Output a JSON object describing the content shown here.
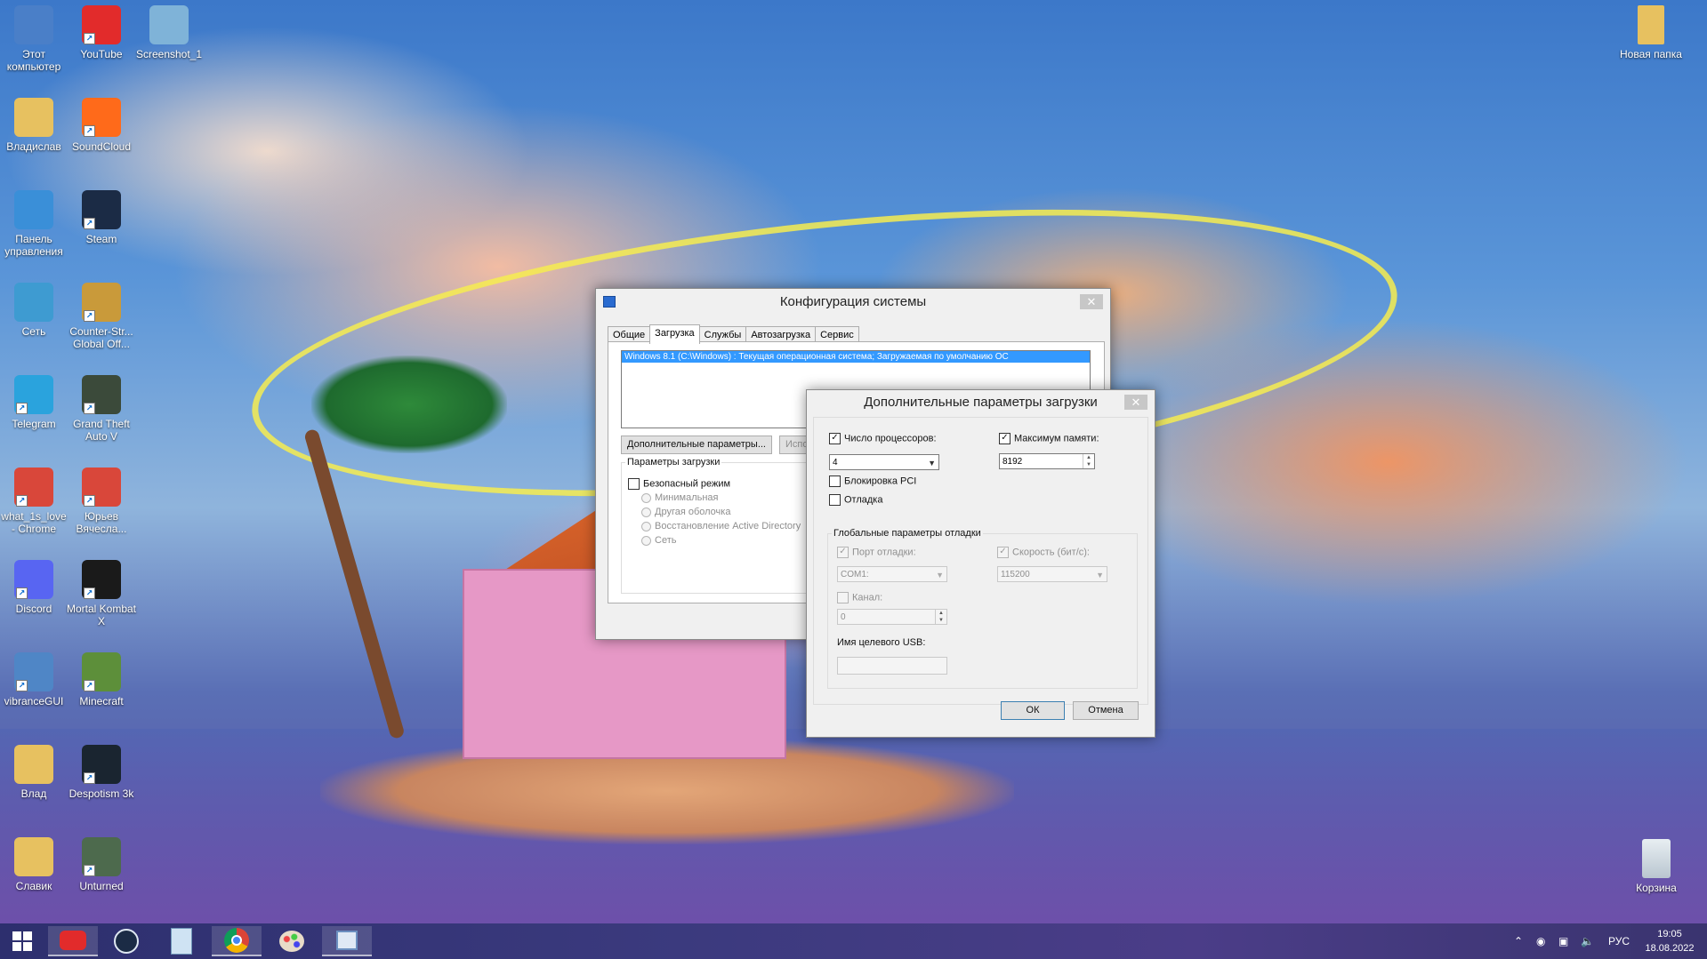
{
  "desktop": {
    "icons_left": [
      {
        "label": "Этот компьютер",
        "icon": "computer-icon",
        "color": "#4a7fc8"
      },
      {
        "label": "YouTube",
        "icon": "youtube-icon",
        "color": "#e22b2b"
      },
      {
        "label": "Screenshot_1",
        "icon": "image-file-icon",
        "color": "#7fb3d8"
      },
      {
        "label": "Владислав",
        "icon": "user-folder-icon",
        "color": "#e7c160"
      },
      {
        "label": "SoundCloud",
        "icon": "soundcloud-icon",
        "color": "#ff6a1a"
      },
      {
        "label": "Панель управления",
        "icon": "control-panel-icon",
        "color": "#3a8fd8"
      },
      {
        "label": "Steam",
        "icon": "steam-icon",
        "color": "#1b2b45"
      },
      {
        "label": "Сеть",
        "icon": "network-icon",
        "color": "#3e9bd1"
      },
      {
        "label": "Counter-Str... Global Off...",
        "icon": "csgo-icon",
        "color": "#c99a3a"
      },
      {
        "label": "Telegram",
        "icon": "telegram-icon",
        "color": "#2aa3dd"
      },
      {
        "label": "Grand Theft Auto V",
        "icon": "gta-icon",
        "color": "#3b4a3a"
      },
      {
        "label": "what_1s_love - Chrome",
        "icon": "chrome-profile-icon",
        "color": "#d9473a"
      },
      {
        "label": "Юрьев Вячесла...",
        "icon": "chrome-profile-icon",
        "color": "#d9473a"
      },
      {
        "label": "Discord",
        "icon": "discord-icon",
        "color": "#5865f2"
      },
      {
        "label": "Mortal Kombat X",
        "icon": "mortal-kombat-icon",
        "color": "#1a1a1a"
      },
      {
        "label": "vibranceGUI",
        "icon": "gear-icon",
        "color": "#4f86c6"
      },
      {
        "label": "Minecraft",
        "icon": "minecraft-icon",
        "color": "#5d8f3a"
      },
      {
        "label": "Влад",
        "icon": "folder-icon",
        "color": "#e7c160"
      },
      {
        "label": "Despotism 3k",
        "icon": "despotism-icon",
        "color": "#1a2530"
      },
      {
        "label": "Славик",
        "icon": "folder-icon",
        "color": "#e7c160"
      },
      {
        "label": "Unturned",
        "icon": "unturned-icon",
        "color": "#4d6a4d"
      }
    ],
    "icon_new_folder": {
      "label": "Новая папка",
      "icon": "folder-icon",
      "color": "#e7c160"
    },
    "icon_recycle": {
      "label": "Корзина",
      "icon": "recycle-bin-icon",
      "color": "#c9d6e0"
    }
  },
  "msconfig": {
    "title": "Конфигурация системы",
    "close": "✕",
    "tabs": [
      "Общие",
      "Загрузка",
      "Службы",
      "Автозагрузка",
      "Сервис"
    ],
    "active_tab": 1,
    "os_entry": "Windows 8.1 (C:\\Windows) : Текущая операционная система; Загружаемая по умолчанию ОС",
    "advanced_button": "Дополнительные параметры...",
    "partial_button": "Испо",
    "boot_options": {
      "title": "Параметры загрузки",
      "safe_mode": "Безопасный режим",
      "minimal": "Минимальная",
      "alt_shell": "Другая оболочка",
      "ad_repair": "Восстановление Active Directory",
      "network": "Сеть"
    }
  },
  "advanced": {
    "title": "Дополнительные параметры загрузки",
    "close": "✕",
    "num_processors_label": "Число процессоров:",
    "num_processors_checked": true,
    "num_processors_value": "4",
    "max_memory_label": "Максимум памяти:",
    "max_memory_checked": true,
    "max_memory_value": "8192",
    "pci_lock": "Блокировка PCI",
    "debug": "Отладка",
    "global_debug_title": "Глобальные параметры отладки",
    "debug_port_label": "Порт отладки:",
    "debug_port_value": "COM1:",
    "baud_label": "Скорость (бит/с):",
    "baud_value": "115200",
    "channel_label": "Канал:",
    "channel_value": "0",
    "usb_target_label": "Имя целевого USB:",
    "ok": "ОК",
    "cancel": "Отмена"
  },
  "taskbar": {
    "apps": [
      {
        "icon": "windows-start-icon"
      },
      {
        "icon": "youtube-icon"
      },
      {
        "icon": "steam-icon"
      },
      {
        "icon": "notepad-icon"
      },
      {
        "icon": "chrome-icon"
      },
      {
        "icon": "paint-icon"
      },
      {
        "icon": "msconfig-icon"
      }
    ],
    "lang": "РУС",
    "time": "19:05",
    "date": "18.08.2022"
  }
}
